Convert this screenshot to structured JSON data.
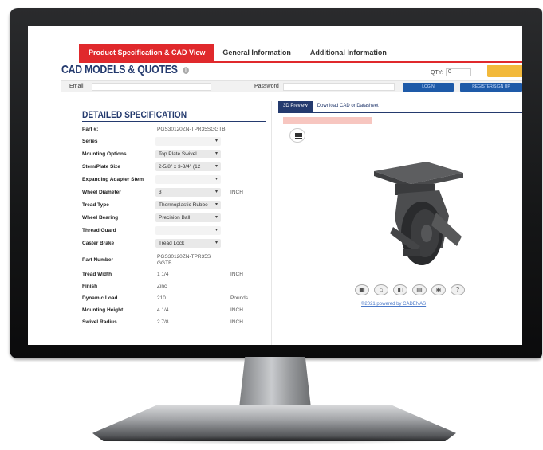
{
  "tabs": [
    "Product Specification & CAD View",
    "General Information",
    "Additional Information"
  ],
  "header": {
    "title": "CAD MODELS & QUOTES",
    "qty_label": "QTY:",
    "qty_value": "0"
  },
  "login": {
    "email_label": "Email",
    "password_label": "Password",
    "login_button": "LOGIN",
    "register_button": "REGISTER/SIGN UP"
  },
  "spec": {
    "title": "DETAILED SPECIFICATION",
    "rows": [
      {
        "label": "Part #:",
        "value": "PGS30120ZN-TPR35SGGTB",
        "unit": ""
      },
      {
        "label": "Series",
        "value": "",
        "unit": ""
      },
      {
        "label": "Mounting Options",
        "value": "Top Plate Swivel",
        "unit": ""
      },
      {
        "label": "Stem/Plate Size",
        "value": "2-5/8\" x 3-3/4\" (12",
        "unit": ""
      },
      {
        "label": "Expanding Adapter Stem",
        "value": "",
        "unit": ""
      },
      {
        "label": "Wheel Diameter",
        "value": "3",
        "unit": "INCH"
      },
      {
        "label": "Tread Type",
        "value": "Thermoplastic Rubbe",
        "unit": ""
      },
      {
        "label": "Wheel Bearing",
        "value": "Precision Ball",
        "unit": ""
      },
      {
        "label": "Thread Guard",
        "value": "",
        "unit": ""
      },
      {
        "label": "Caster Brake",
        "value": "Tread Lock",
        "unit": ""
      },
      {
        "label": "Part Number",
        "value": "PGS30120ZN-TPR35SGGTB",
        "unit": ""
      },
      {
        "label": "Tread Width",
        "value": "1 1/4",
        "unit": "INCH"
      },
      {
        "label": "Finish",
        "value": "Zinc",
        "unit": ""
      },
      {
        "label": "Dynamic Load",
        "value": "210",
        "unit": "Pounds"
      },
      {
        "label": "Mounting Height",
        "value": "4 1/4",
        "unit": "INCH"
      },
      {
        "label": "Swivel Radius",
        "value": "2 7/8",
        "unit": "INCH"
      }
    ]
  },
  "viewer": {
    "tab_preview": "3D Preview",
    "tab_download": "Download CAD or Datasheet",
    "powered_by": "©2021 powered by CADENAS",
    "help_icon": "?"
  },
  "colors": {
    "accent_red": "#e0292c",
    "navy": "#243a6e",
    "login_blue": "#1e5aa8",
    "gold": "#f2b93b"
  }
}
